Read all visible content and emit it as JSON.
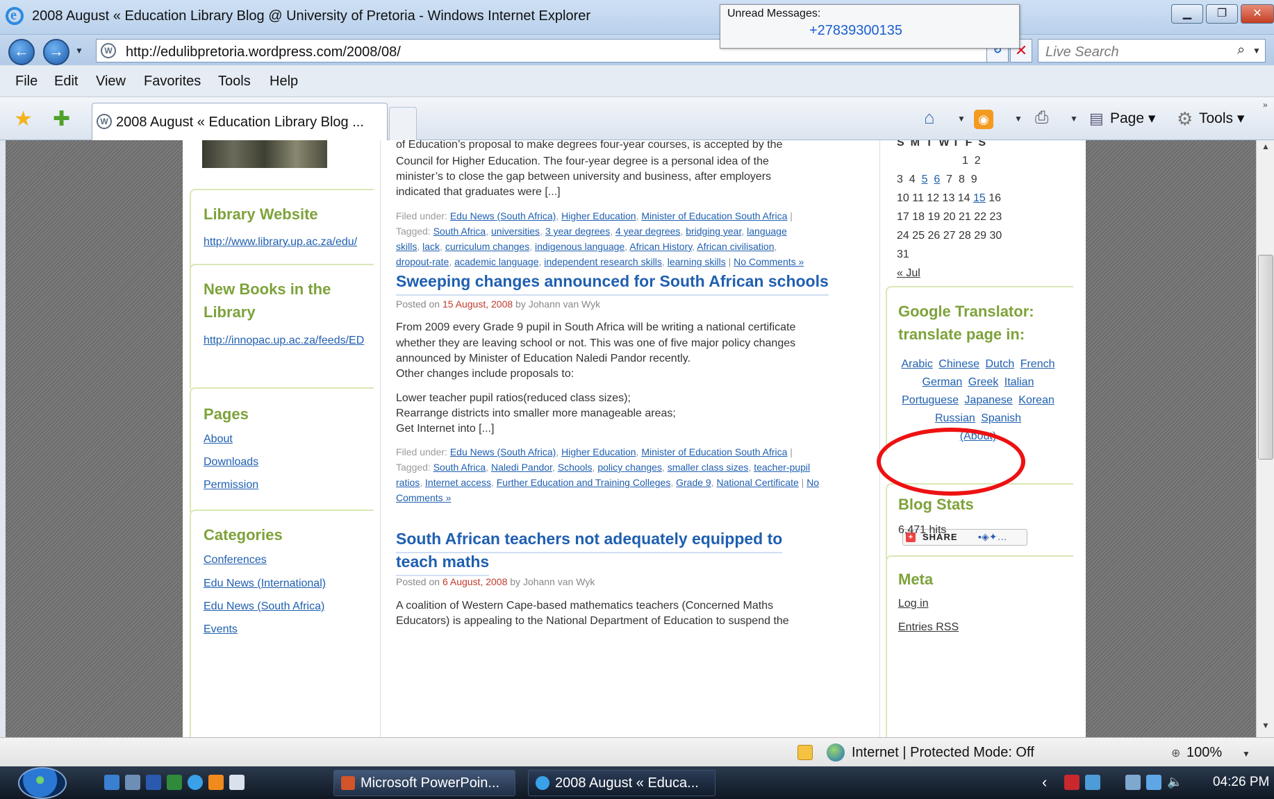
{
  "window": {
    "title": "2008 August « Education Library Blog @ University of Pretoria - Windows Internet Explorer",
    "minimize": "▁",
    "maximize": "❐",
    "close": "✕"
  },
  "notification": {
    "title": "Unread Messages:",
    "body": "+27839300135"
  },
  "address_bar": {
    "url": "http://edulibpretoria.wordpress.com/2008/08/",
    "back": "←",
    "forward": "→"
  },
  "search": {
    "placeholder": "Live Search"
  },
  "menu": [
    "File",
    "Edit",
    "View",
    "Favorites",
    "Tools",
    "Help"
  ],
  "tab": {
    "label": "2008 August « Education Library Blog ..."
  },
  "toolbar": {
    "page": "Page ▾",
    "tools": "Tools ▾"
  },
  "left_sidebar": {
    "library_website": {
      "title": "Library Website",
      "link": "http://www.library.up.ac.za/edu/"
    },
    "new_books": {
      "title_line1": "New Books in the",
      "title_line2": "Library",
      "link": "http://innopac.up.ac.za/feeds/ED"
    },
    "pages": {
      "title": "Pages",
      "items": [
        "About",
        "Downloads",
        "Permission"
      ]
    },
    "categories": {
      "title": "Categories",
      "items": [
        "Conferences",
        "Edu News (International)",
        "Edu News (South Africa)",
        "Events"
      ]
    }
  },
  "main": {
    "post0": {
      "lines": [
        "of Education’s proposal to make degrees four-year courses, is accepted by the",
        "Council for Higher Education. The four-year degree is a personal idea of the",
        "minister’s to close the gap between university and business, after employers",
        "indicated that graduates were [...]"
      ],
      "filed_prefix": "Filed under:",
      "filed_links": [
        "Edu News (South Africa)",
        "Higher Education",
        "Minister of Education South Africa"
      ],
      "tagged_prefix": "Tagged:",
      "tag_line1": [
        "South Africa",
        "universities",
        "3 year degrees",
        "4 year degrees",
        "bridging year",
        "language"
      ],
      "tag_line2": [
        "skills",
        "lack",
        "curriculum changes",
        "indigenous language",
        "African History",
        "African civilisation"
      ],
      "tag_line3": [
        "dropout-rate",
        "academic language",
        "independent research skills",
        "learning skills"
      ],
      "comments": "No Comments »"
    },
    "post1": {
      "title": "Sweeping changes announced for South African schools",
      "posted_on": "Posted on",
      "date": "15 August, 2008",
      "by": "by Johann van Wyk",
      "lines": [
        "From 2009 every Grade 9 pupil in South Africa will be writing a national certificate",
        "whether they are leaving school or not. This was one of five major policy changes",
        "announced by Minister of Education Naledi Pandor recently.",
        "Other changes include proposals to:"
      ],
      "lines2": [
        "Lower teacher pupil ratios(reduced class sizes);",
        "Rearrange districts into smaller more manageable areas;",
        "Get Internet into [...]"
      ],
      "filed_prefix": "Filed under:",
      "filed_links": [
        "Edu News (South Africa)",
        "Higher Education",
        "Minister of Education South Africa"
      ],
      "tagged_prefix": "Tagged:",
      "tag_line1": [
        "South Africa",
        "Naledi Pandor",
        "Schools",
        "policy changes",
        "smaller class sizes",
        "teacher-pupil"
      ],
      "tag_line2": [
        "ratios",
        "Internet access",
        "Further Education and Training Colleges",
        "Grade 9",
        "National Certificate",
        "No"
      ],
      "comments": "Comments »"
    },
    "post2": {
      "title_line1": "South African teachers not adequately equipped to",
      "title_line2": "teach maths",
      "posted_on": "Posted on",
      "date": "6 August, 2008",
      "by": "by Johann van Wyk",
      "lines": [
        "A coalition of Western Cape-based mathematics teachers (Concerned Maths",
        "Educators) is appealing to the National Department of Education to suspend the"
      ]
    }
  },
  "right_sidebar": {
    "calendar": {
      "header": "S  M  T  W T  F  S",
      "rows": [
        "                        1  2",
        "3  4  5  6  7  8  9",
        "10 11 12 13 14 15 16",
        "17 18 19 20 21 22 23",
        "24 25 26 27 28 29 30",
        "31"
      ],
      "prev": "« Jul"
    },
    "translator": {
      "title_line1": "Google Translator:",
      "title_line2": "translate page in:",
      "languages": [
        "Arabic",
        "Chinese",
        "Dutch",
        "French",
        "German",
        "Greek",
        "Italian",
        "Portuguese",
        "Japanese",
        "Korean",
        "Russian",
        "Spanish"
      ],
      "about": "(About)"
    },
    "share": {
      "label": "SHARE"
    },
    "blog_stats": {
      "title": "Blog Stats",
      "hits": "6,471 hits"
    },
    "meta": {
      "title": "Meta",
      "items": [
        "Log in",
        "Entries RSS"
      ]
    }
  },
  "status_bar": {
    "zone": "Internet | Protected Mode: Off",
    "zoom": "100%"
  },
  "taskbar": {
    "tasks": [
      "Microsoft PowerPoin...",
      "2008 August « Educa..."
    ],
    "clock": "04:26 PM"
  },
  "colors": {
    "accent_green": "#7ea23b",
    "link_blue": "#1f5fb0",
    "date_red": "#c0392b",
    "highlight_red": "#ee1111"
  }
}
